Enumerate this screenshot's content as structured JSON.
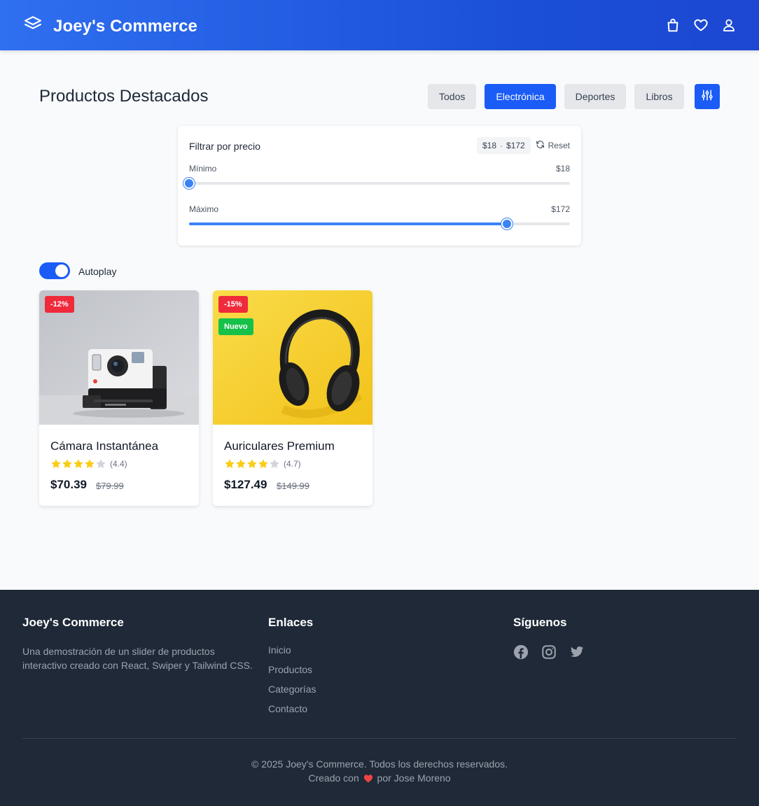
{
  "header": {
    "brand": "Joey's Commerce",
    "logo_icon": "layers-icon",
    "icons": [
      "shopping-bag-icon",
      "heart-icon",
      "user-icon"
    ]
  },
  "main": {
    "title": "Productos Destacados",
    "categories": [
      {
        "label": "Todos",
        "active": false
      },
      {
        "label": "Electrónica",
        "active": true
      },
      {
        "label": "Deportes",
        "active": false
      },
      {
        "label": "Libros",
        "active": false
      }
    ],
    "filter_icon": "sliders-icon"
  },
  "price_filter": {
    "label": "Filtrar por precio",
    "range_min": "$18",
    "range_sep": "-",
    "range_max": "$172",
    "reset_label": "Reset",
    "min_label": "Mínimo",
    "min_value": "$18",
    "max_label": "Máximo",
    "max_value": "$172",
    "min_fraction": 0.0,
    "max_fraction": 0.835
  },
  "autoplay": {
    "label": "Autoplay",
    "on": true
  },
  "products": [
    {
      "name": "Cámara Instantánea",
      "discount": "-12%",
      "new_badge": "",
      "stars": 4,
      "rating": "(4.4)",
      "price": "$70.39",
      "old_price": "$79.99"
    },
    {
      "name": "Auriculares Premium",
      "discount": "-15%",
      "new_badge": "Nuevo",
      "stars": 4,
      "rating": "(4.7)",
      "price": "$127.49",
      "old_price": "$149.99"
    }
  ],
  "footer": {
    "brand": "Joey's Commerce",
    "description": "Una demostración de un slider de productos interactivo creado con React, Swiper y Tailwind CSS.",
    "links_title": "Enlaces",
    "links": [
      "Inicio",
      "Productos",
      "Categorías",
      "Contacto"
    ],
    "social_title": "Síguenos",
    "social_icons": [
      "facebook-icon",
      "instagram-icon",
      "twitter-icon"
    ],
    "copyright": "© 2025 Joey's Commerce. Todos los derechos reservados.",
    "credit_prefix": "Creado con",
    "credit_suffix": "por Jose Moreno"
  },
  "colors": {
    "primary": "#1a5cf5",
    "slider": "#3b82f6",
    "sale_badge": "#ef2b3b",
    "new_badge": "#16c14a",
    "star": "#facc15",
    "footer_bg": "#1f2937"
  }
}
